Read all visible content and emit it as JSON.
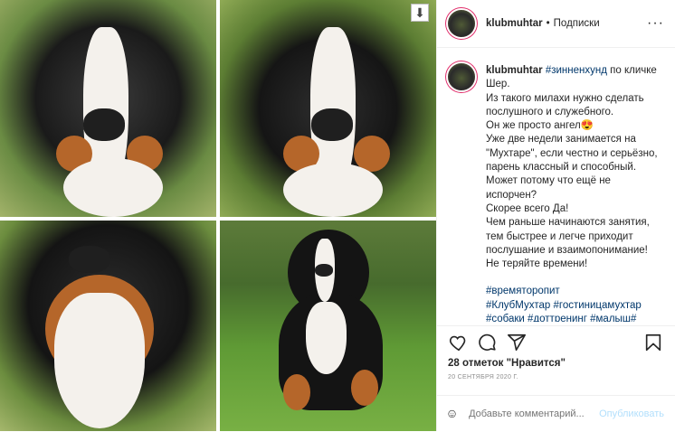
{
  "header": {
    "username": "klubmuhtar",
    "separator": "•",
    "follow_label": "Подписки",
    "more_glyph": "···"
  },
  "caption": {
    "username": "klubmuhtar",
    "hashtag_inline": "#зинненхунд",
    "body_first": " по кличке Шер.",
    "body_rest": "Из такого милахи нужно сделать послушного и служебного.\nОн же просто ангел😍\nУже две недели занимается на \"Мухтаре\", если честно и серьёзно, парень классный и способный.\nМожет потому что ещё не испорчен?\nСкорее всего Да!\nЧем раньше начинаются занятия, тем быстрее и легче приходит послушание и взаимопонимание!\nНе теряйте времени!",
    "hashtags": "#времяторопит\n#КлубМухтар #гостиницамухтар\n#собаки #доттренинг #малыш#\nзанятиясобакой#ивановопередер"
  },
  "actions": {
    "like": "heart-icon",
    "comment": "comment-icon",
    "share": "share-icon",
    "save": "bookmark-icon"
  },
  "likes": {
    "count": "28 отметок",
    "text": "\"Нравится\""
  },
  "date": "20 СЕНТЯБРЯ 2020 Г.",
  "add_comment": {
    "placeholder": "Добавьте комментарий...",
    "post_label": "Опубликовать"
  },
  "colors": {
    "link": "#00376b",
    "post_disabled": "#b2dffc",
    "story_ring": "#e1306c"
  }
}
